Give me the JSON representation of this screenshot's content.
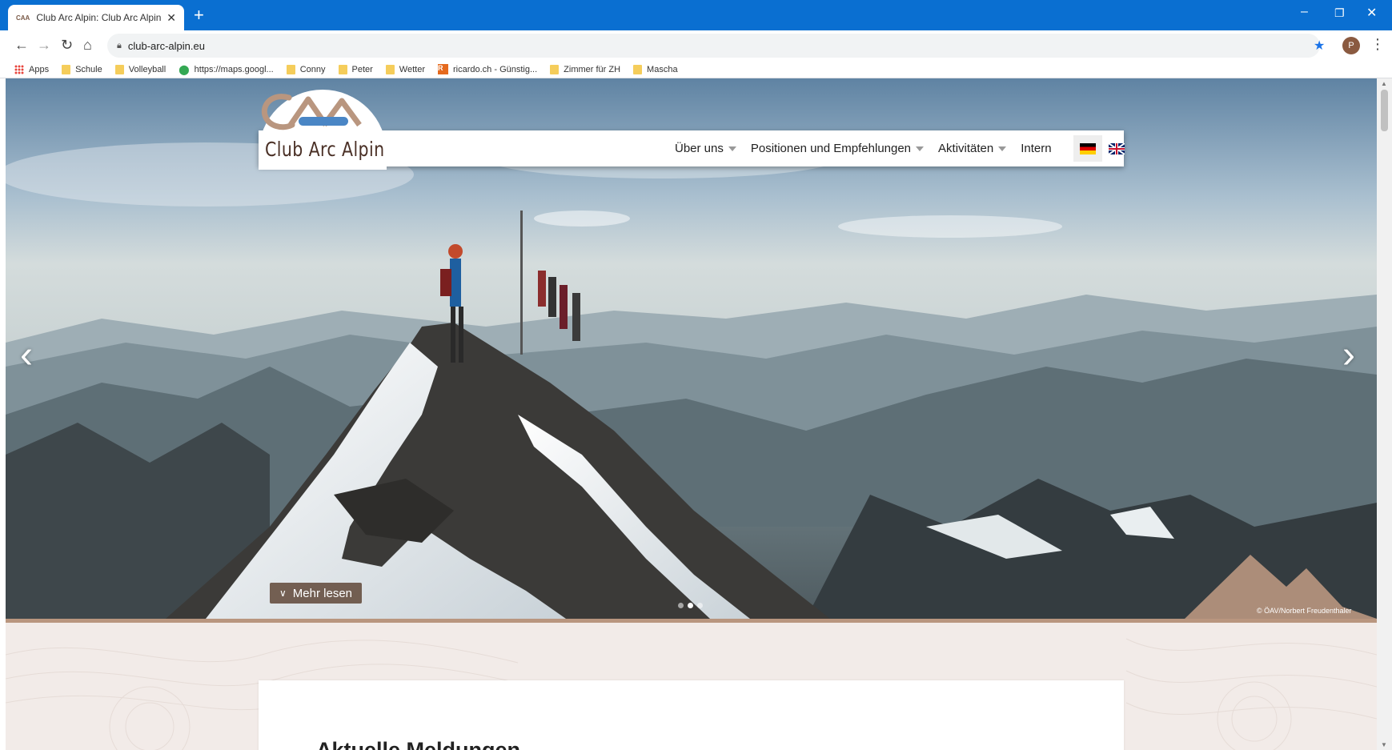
{
  "browser": {
    "tab_title": "Club Arc Alpin: Club Arc Alpin (C",
    "tab_favicon": "CAA",
    "new_tab": "+",
    "url": "club-arc-alpin.eu",
    "profile_initial": "P",
    "bookmarks": [
      {
        "label": "Apps",
        "icon": "apps-icon"
      },
      {
        "label": "Schule",
        "icon": "folder-icon"
      },
      {
        "label": "Volleyball",
        "icon": "folder-icon"
      },
      {
        "label": "https://maps.googl...",
        "icon": "maps-icon"
      },
      {
        "label": "Conny",
        "icon": "folder-icon"
      },
      {
        "label": "Peter",
        "icon": "folder-icon"
      },
      {
        "label": "Wetter",
        "icon": "folder-icon"
      },
      {
        "label": "ricardo.ch - Günstig...",
        "icon": "ricardo-icon"
      },
      {
        "label": "Zimmer für ZH",
        "icon": "folder-icon"
      },
      {
        "label": "Mascha",
        "icon": "folder-icon"
      }
    ]
  },
  "site": {
    "logo_text": "Club Arc Alpin",
    "nav": [
      {
        "label": "Über uns",
        "dropdown": true
      },
      {
        "label": "Positionen und Empfehlungen",
        "dropdown": true
      },
      {
        "label": "Aktivitäten",
        "dropdown": true
      },
      {
        "label": "Intern",
        "dropdown": false
      }
    ],
    "languages": [
      "de",
      "en"
    ],
    "hero": {
      "read_more": "Mehr lesen",
      "credit": "© ÖAV/Norbert Freudenthaler",
      "slides": 3,
      "active_slide": 2
    },
    "section_title": "Aktuelle Meldungen"
  },
  "colors": {
    "chrome_blue": "#0a6fd1",
    "brand_brown": "#4a3026",
    "brand_tan": "#b9967f",
    "brand_blue": "#4a86c5",
    "page_bg": "#f2ebe8"
  }
}
